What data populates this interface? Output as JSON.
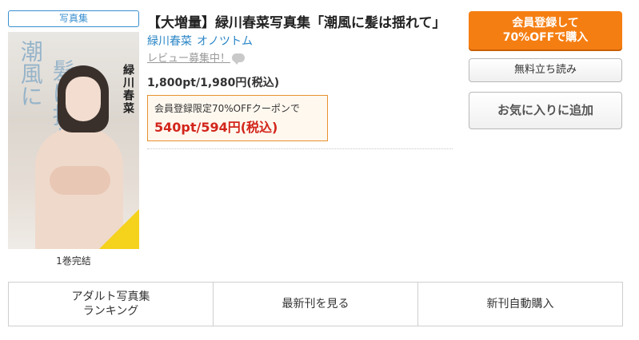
{
  "product": {
    "category": "写真集",
    "title": "【大増量】緑川春菜写真集「潮風に髪は揺れて」",
    "authors": [
      "緑川春菜",
      "オノツトム"
    ],
    "review_text": "レビュー募集中！",
    "price": "1,800pt/1,980円(税込)",
    "coupon": {
      "label": "会員登録限定70%OFFクーポンで",
      "price": "540pt/594円(税込)"
    },
    "volume_note": "1巻完結"
  },
  "cover": {
    "calligraphy_1": "潮風に",
    "calligraphy_2": "髪は揺れて",
    "name_vertical": "緑川春菜"
  },
  "actions": {
    "register_line1": "会員登録して",
    "register_line2": "70%OFFで購入",
    "trial": "無料立ち読み",
    "favorite": "お気に入りに追加"
  },
  "bottom_tabs": [
    {
      "line1": "アダルト写真集",
      "line2": "ランキング"
    },
    {
      "line1": "最新刊を見る",
      "line2": ""
    },
    {
      "line1": "新刊自動購入",
      "line2": ""
    }
  ],
  "colors": {
    "accent_orange": "#f57e12",
    "link_blue": "#2b86c6",
    "coupon_red": "#d2251b"
  }
}
